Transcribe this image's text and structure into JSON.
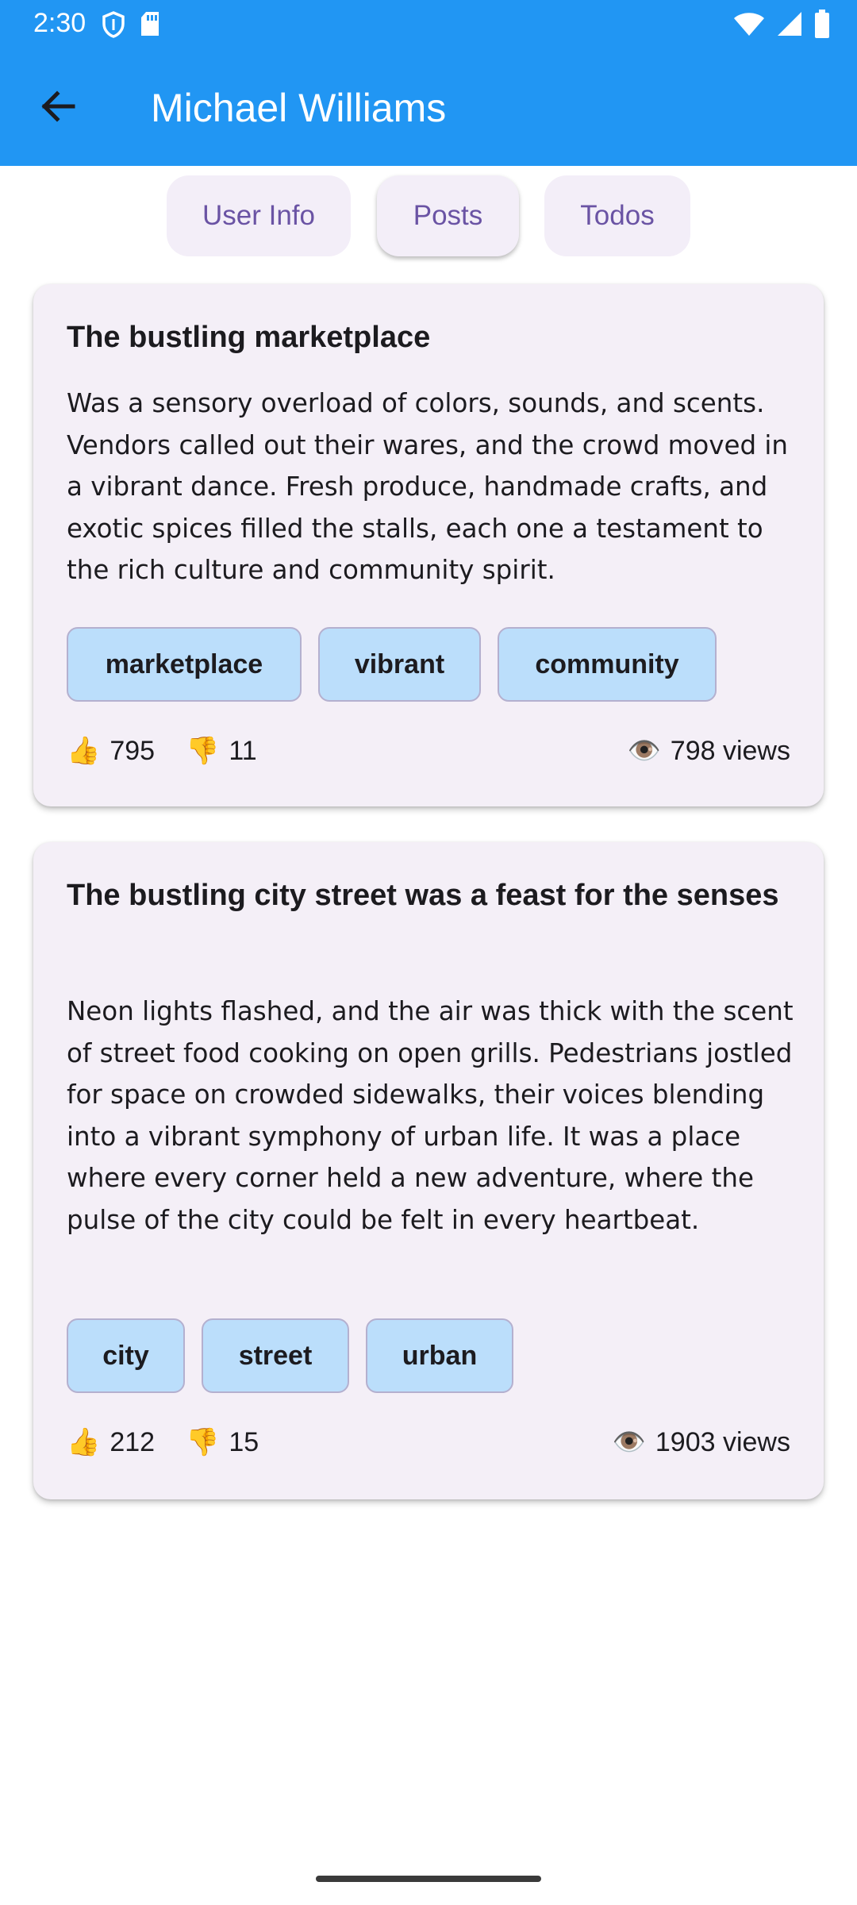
{
  "status_bar": {
    "time": "2:30",
    "left_icons": [
      "shield-icon",
      "sd-card-icon"
    ],
    "right_icons": [
      "wifi-icon",
      "signal-icon",
      "battery-icon"
    ]
  },
  "app_bar": {
    "title": "Michael Williams",
    "background": "#2196f3"
  },
  "tabs": [
    {
      "label": "User Info",
      "selected": false
    },
    {
      "label": "Posts",
      "selected": true
    },
    {
      "label": "Todos",
      "selected": false
    }
  ],
  "posts": [
    {
      "title": "The bustling marketplace",
      "body": "Was a sensory overload of colors, sounds, and scents. Vendors called out their wares, and the crowd moved in a vibrant dance. Fresh produce, handmade crafts, and exotic spices filled the stalls, each one a testament to the rich culture and community spirit.",
      "tags": [
        "marketplace",
        "vibrant",
        "community"
      ],
      "likes": "795",
      "dislikes": "11",
      "views": "798 views"
    },
    {
      "title": "The bustling city street was a feast for the senses",
      "body": "Neon lights flashed, and the air was thick with the scent of street food cooking on open grills. Pedestrians jostled for space on crowded sidewalks, their voices blending into a vibrant symphony of urban life. It was a place where every corner held a new adventure, where the pulse of the city could be felt in every heartbeat.",
      "tags": [
        "city",
        "street",
        "urban"
      ],
      "likes": "212",
      "dislikes": "15",
      "views": "1903 views"
    }
  ],
  "icons": {
    "like": "👍",
    "dislike": "👎",
    "views": "👁️"
  },
  "colors": {
    "card_background": "#f4eff7",
    "tag_background": "#bbdefb",
    "tab_text": "#6a53a4"
  }
}
